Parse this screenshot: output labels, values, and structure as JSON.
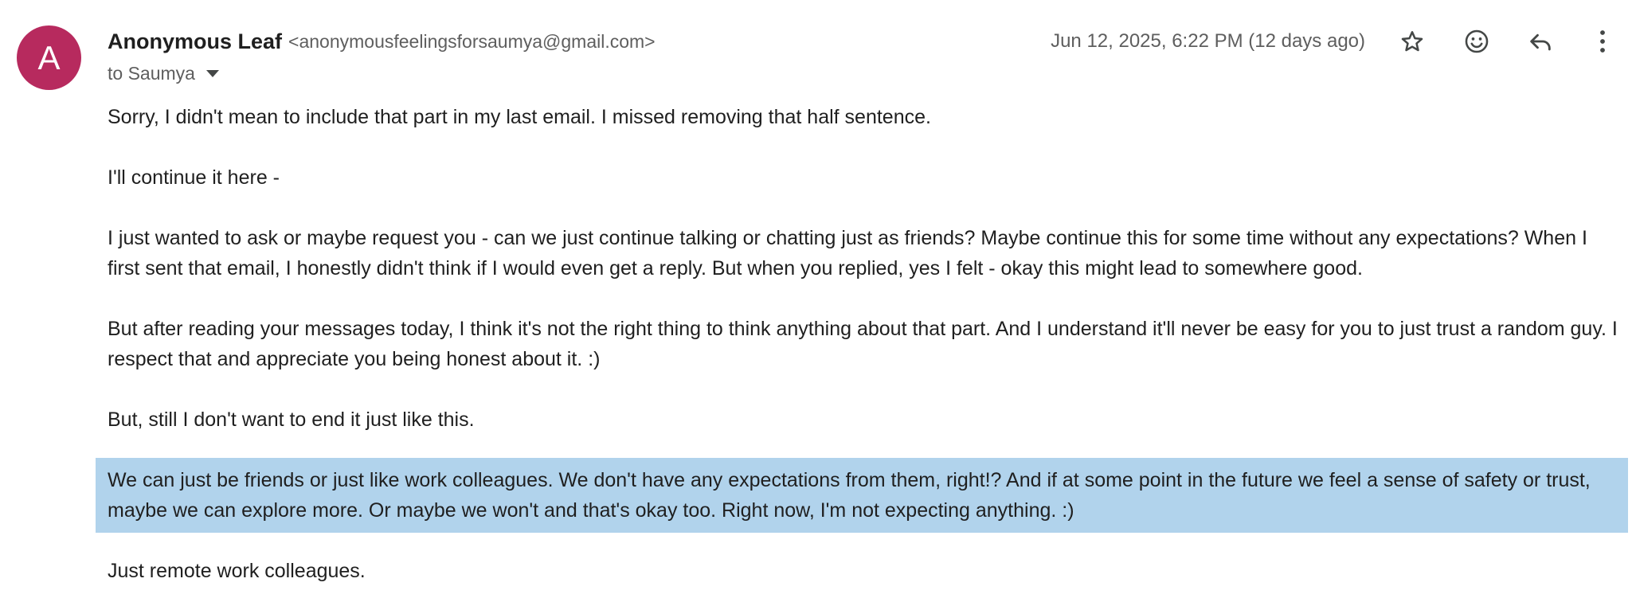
{
  "sender": {
    "avatar_letter": "A",
    "name": "Anonymous Leaf",
    "email": "<anonymousfeelingsforsaumya@gmail.com>"
  },
  "recipient_label": "to Saumya",
  "date": "Jun 12, 2025, 6:22 PM (12 days ago)",
  "actions": [
    "star-icon",
    "emoji-icon",
    "reply-icon",
    "more-vert-icon"
  ],
  "colors": {
    "avatar": "#b72a5e",
    "highlight": "#b1d3ec"
  },
  "body": {
    "paragraphs": [
      "Sorry, I didn't mean to include that part in my last email. I missed removing that half sentence.",
      "I'll continue it here -",
      "I just wanted to ask or maybe request you - can we just continue talking or chatting just as friends? Maybe continue this for some time without any expectations? When I first sent that email, I honestly didn't think if I would even get a reply. But when you replied, yes I felt - okay this might lead to somewhere good.",
      "But after reading your messages today, I think it's not the right thing to think anything about that part. And I understand it'll never be easy for you to just trust a random guy. I respect that and appreciate you being honest about it. :)",
      "But, still I don't want to end it just like this.",
      "We can just be friends or just like work colleagues. We don't have any expectations from them, right!? And if at some point in the future we feel a sense of safety or trust, maybe we can explore more. Or maybe we won't and that's okay too. Right now, I'm not expecting anything. :)",
      "Just remote work colleagues."
    ]
  }
}
